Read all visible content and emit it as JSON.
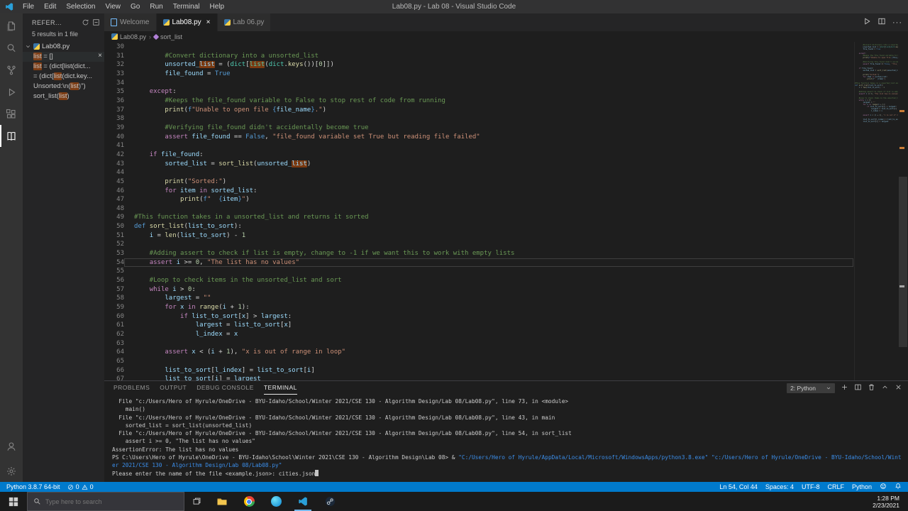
{
  "title_bar": {
    "title": "Lab08.py - Lab 08 - Visual Studio Code",
    "menus": [
      "File",
      "Edit",
      "Selection",
      "View",
      "Go",
      "Run",
      "Terminal",
      "Help"
    ]
  },
  "activity_bar": {
    "items": [
      "explorer",
      "search",
      "source-control",
      "run-and-debug",
      "extensions",
      "references"
    ],
    "active": "references",
    "bottom_items": [
      "account",
      "settings"
    ]
  },
  "sidebar": {
    "header": "REFER...",
    "summary": "5 results in 1 file",
    "file_name": "Lab08.py",
    "results": [
      {
        "active": true,
        "close": true,
        "segments": [
          {
            "t": "list",
            "h": true
          },
          {
            "t": " = []"
          }
        ]
      },
      {
        "segments": [
          {
            "t": "list",
            "h": true
          },
          {
            "t": " = (dict[list(dict..."
          }
        ]
      },
      {
        "segments": [
          {
            "t": "= (dict["
          },
          {
            "t": "list",
            "h": true
          },
          {
            "t": "(dict.key..."
          }
        ]
      },
      {
        "segments": [
          {
            "t": "Unsorted:\\n("
          },
          {
            "t": "list",
            "h": true
          },
          {
            "t": ")\")"
          }
        ]
      },
      {
        "segments": [
          {
            "t": "sort_list("
          },
          {
            "t": "list",
            "h": true
          },
          {
            "t": ")"
          }
        ]
      }
    ]
  },
  "editor_tabs": [
    {
      "label": "Welcome",
      "icon": "file",
      "active": false,
      "close": false
    },
    {
      "label": "Lab08.py",
      "icon": "python",
      "active": true,
      "close": true
    },
    {
      "label": "Lab 06.py",
      "icon": "python",
      "active": false,
      "close": false
    }
  ],
  "breadcrumbs": [
    {
      "label": "Lab08.py",
      "icon": "python"
    },
    {
      "label": "sort_list",
      "icon": "symbol-method"
    }
  ],
  "editor": {
    "current_line": 54,
    "lines": [
      {
        "n": 30,
        "tk": []
      },
      {
        "n": 31,
        "tk": [
          [
            "cm",
            "        #Convert dictionary into a unsorted_list"
          ]
        ]
      },
      {
        "n": 32,
        "tk": [
          [
            "op",
            "        "
          ],
          [
            "vr",
            "unsorted_"
          ],
          [
            "vr",
            "list",
            1
          ],
          [
            "op",
            " = ("
          ],
          [
            "ty",
            "dict"
          ],
          [
            "op",
            "["
          ],
          [
            "ty",
            "list",
            1
          ],
          [
            "op",
            "("
          ],
          [
            "ty",
            "dict"
          ],
          [
            "op",
            "."
          ],
          [
            "fn",
            "keys"
          ],
          [
            "op",
            "())["
          ],
          [
            "nu",
            "0"
          ],
          [
            "op",
            "]])"
          ]
        ]
      },
      {
        "n": 33,
        "tk": [
          [
            "op",
            "        "
          ],
          [
            "vr",
            "file_found"
          ],
          [
            "op",
            " = "
          ],
          [
            "kb",
            "True"
          ]
        ]
      },
      {
        "n": 34,
        "tk": []
      },
      {
        "n": 35,
        "tk": [
          [
            "op",
            "    "
          ],
          [
            "kw",
            "except"
          ],
          [
            "op",
            ":"
          ]
        ]
      },
      {
        "n": 36,
        "tk": [
          [
            "cm",
            "        #Keeps the file_found variable to False to stop rest of code from running"
          ]
        ]
      },
      {
        "n": 37,
        "tk": [
          [
            "op",
            "        "
          ],
          [
            "fn",
            "print"
          ],
          [
            "op",
            "("
          ],
          [
            "kb",
            "f"
          ],
          [
            "st",
            "\"Unable to open file "
          ],
          [
            "fb",
            "{"
          ],
          [
            "vr",
            "file_name"
          ],
          [
            "fb",
            "}"
          ],
          [
            "st",
            ".\""
          ],
          [
            "op",
            ")"
          ]
        ]
      },
      {
        "n": 38,
        "tk": []
      },
      {
        "n": 39,
        "tk": [
          [
            "cm",
            "        #Verifying file_found didn't accidentally become true"
          ]
        ]
      },
      {
        "n": 40,
        "tk": [
          [
            "op",
            "        "
          ],
          [
            "kw",
            "assert"
          ],
          [
            "op",
            " "
          ],
          [
            "vr",
            "file_found"
          ],
          [
            "op",
            " == "
          ],
          [
            "kb",
            "False"
          ],
          [
            "op",
            ", "
          ],
          [
            "st",
            "\"file_found variable set True but reading file failed\""
          ]
        ]
      },
      {
        "n": 41,
        "tk": []
      },
      {
        "n": 42,
        "tk": [
          [
            "op",
            "    "
          ],
          [
            "kw",
            "if"
          ],
          [
            "op",
            " "
          ],
          [
            "vr",
            "file_found"
          ],
          [
            "op",
            ":"
          ]
        ]
      },
      {
        "n": 43,
        "tk": [
          [
            "op",
            "        "
          ],
          [
            "vr",
            "sorted_list"
          ],
          [
            "op",
            " = "
          ],
          [
            "fn",
            "sort_list"
          ],
          [
            "op",
            "("
          ],
          [
            "vr",
            "unsorted_"
          ],
          [
            "vr",
            "list",
            1
          ],
          [
            "op",
            ")"
          ]
        ]
      },
      {
        "n": 44,
        "tk": []
      },
      {
        "n": 45,
        "tk": [
          [
            "op",
            "        "
          ],
          [
            "fn",
            "print"
          ],
          [
            "op",
            "("
          ],
          [
            "st",
            "\"Sorted:\""
          ],
          [
            "op",
            ")"
          ]
        ]
      },
      {
        "n": 46,
        "tk": [
          [
            "op",
            "        "
          ],
          [
            "kw",
            "for"
          ],
          [
            "op",
            " "
          ],
          [
            "vr",
            "item"
          ],
          [
            "op",
            " "
          ],
          [
            "kw",
            "in"
          ],
          [
            "op",
            " "
          ],
          [
            "vr",
            "sorted_list"
          ],
          [
            "op",
            ":"
          ]
        ]
      },
      {
        "n": 47,
        "tk": [
          [
            "op",
            "            "
          ],
          [
            "fn",
            "print"
          ],
          [
            "op",
            "("
          ],
          [
            "kb",
            "f"
          ],
          [
            "st",
            "\"  "
          ],
          [
            "fb",
            "{"
          ],
          [
            "vr",
            "item"
          ],
          [
            "fb",
            "}"
          ],
          [
            "st",
            "\""
          ],
          [
            "op",
            ")"
          ]
        ]
      },
      {
        "n": 48,
        "tk": []
      },
      {
        "n": 49,
        "tk": [
          [
            "cm",
            "#This function takes in a unsorted_list and returns it sorted"
          ]
        ]
      },
      {
        "n": 50,
        "tk": [
          [
            "kb",
            "def"
          ],
          [
            "op",
            " "
          ],
          [
            "fn",
            "sort_list"
          ],
          [
            "op",
            "("
          ],
          [
            "vr",
            "list_to_sort"
          ],
          [
            "op",
            "):"
          ]
        ]
      },
      {
        "n": 51,
        "tk": [
          [
            "op",
            "    "
          ],
          [
            "vr",
            "i"
          ],
          [
            "op",
            " = "
          ],
          [
            "fn",
            "len"
          ],
          [
            "op",
            "("
          ],
          [
            "vr",
            "list_to_sort"
          ],
          [
            "op",
            ") - "
          ],
          [
            "nu",
            "1"
          ]
        ]
      },
      {
        "n": 52,
        "tk": []
      },
      {
        "n": 53,
        "tk": [
          [
            "cm",
            "    #Adding assert to check if list is empty, change to -1 if we want this to work with empty lists"
          ]
        ]
      },
      {
        "n": 54,
        "tk": [
          [
            "op",
            "    "
          ],
          [
            "kw",
            "assert"
          ],
          [
            "op",
            " "
          ],
          [
            "vr",
            "i"
          ],
          [
            "op",
            " >= "
          ],
          [
            "nu",
            "0"
          ],
          [
            "op",
            ", "
          ],
          [
            "st",
            "\"The list has no values\""
          ]
        ]
      },
      {
        "n": 55,
        "tk": []
      },
      {
        "n": 56,
        "tk": [
          [
            "cm",
            "    #Loop to check items in the unsorted_list and sort"
          ]
        ]
      },
      {
        "n": 57,
        "tk": [
          [
            "op",
            "    "
          ],
          [
            "kw",
            "while"
          ],
          [
            "op",
            " "
          ],
          [
            "vr",
            "i"
          ],
          [
            "op",
            " > "
          ],
          [
            "nu",
            "0"
          ],
          [
            "op",
            ":"
          ]
        ]
      },
      {
        "n": 58,
        "tk": [
          [
            "op",
            "        "
          ],
          [
            "vr",
            "largest"
          ],
          [
            "op",
            " = "
          ],
          [
            "st",
            "\"\""
          ]
        ]
      },
      {
        "n": 59,
        "tk": [
          [
            "op",
            "        "
          ],
          [
            "kw",
            "for"
          ],
          [
            "op",
            " "
          ],
          [
            "vr",
            "x"
          ],
          [
            "op",
            " "
          ],
          [
            "kw",
            "in"
          ],
          [
            "op",
            " "
          ],
          [
            "fn",
            "range"
          ],
          [
            "op",
            "("
          ],
          [
            "vr",
            "i"
          ],
          [
            "op",
            " + "
          ],
          [
            "nu",
            "1"
          ],
          [
            "op",
            "):"
          ]
        ]
      },
      {
        "n": 60,
        "tk": [
          [
            "op",
            "            "
          ],
          [
            "kw",
            "if"
          ],
          [
            "op",
            " "
          ],
          [
            "vr",
            "list_to_sort"
          ],
          [
            "op",
            "["
          ],
          [
            "vr",
            "x"
          ],
          [
            "op",
            "] > "
          ],
          [
            "vr",
            "largest"
          ],
          [
            "op",
            ":"
          ]
        ]
      },
      {
        "n": 61,
        "tk": [
          [
            "op",
            "                "
          ],
          [
            "vr",
            "largest"
          ],
          [
            "op",
            " = "
          ],
          [
            "vr",
            "list_to_sort"
          ],
          [
            "op",
            "["
          ],
          [
            "vr",
            "x"
          ],
          [
            "op",
            "]"
          ]
        ]
      },
      {
        "n": 62,
        "tk": [
          [
            "op",
            "                "
          ],
          [
            "vr",
            "l_index"
          ],
          [
            "op",
            " = "
          ],
          [
            "vr",
            "x"
          ]
        ]
      },
      {
        "n": 63,
        "tk": []
      },
      {
        "n": 64,
        "tk": [
          [
            "op",
            "        "
          ],
          [
            "kw",
            "assert"
          ],
          [
            "op",
            " "
          ],
          [
            "vr",
            "x"
          ],
          [
            "op",
            " < ("
          ],
          [
            "vr",
            "i"
          ],
          [
            "op",
            " + "
          ],
          [
            "nu",
            "1"
          ],
          [
            "op",
            "), "
          ],
          [
            "st",
            "\"x is out of range in loop\""
          ]
        ]
      },
      {
        "n": 65,
        "tk": []
      },
      {
        "n": 66,
        "tk": [
          [
            "op",
            "        "
          ],
          [
            "vr",
            "list_to_sort"
          ],
          [
            "op",
            "["
          ],
          [
            "vr",
            "l_index"
          ],
          [
            "op",
            "] = "
          ],
          [
            "vr",
            "list_to_sort"
          ],
          [
            "op",
            "["
          ],
          [
            "vr",
            "i"
          ],
          [
            "op",
            "]"
          ]
        ]
      },
      {
        "n": 67,
        "tk": [
          [
            "op",
            "        "
          ],
          [
            "vr",
            "list_to_sort"
          ],
          [
            "op",
            "["
          ],
          [
            "vr",
            "i"
          ],
          [
            "op",
            "] = "
          ],
          [
            "vr",
            "largest"
          ]
        ]
      }
    ]
  },
  "panel": {
    "tabs": [
      "PROBLEMS",
      "OUTPUT",
      "DEBUG CONSOLE",
      "TERMINAL"
    ],
    "active_tab": "TERMINAL",
    "terminal_selector": "2: Python",
    "terminal_lines": [
      {
        "s": [
          {
            "t": "  File \"c:/Users/Hero of Hyrule/OneDrive - BYU-Idaho/School/Winter 2021/CSE 130 - Algorithm Design/Lab 08/Lab08.py\", line 73, in <module>"
          }
        ]
      },
      {
        "s": [
          {
            "t": "    main()"
          }
        ]
      },
      {
        "s": [
          {
            "t": "  File \"c:/Users/Hero of Hyrule/OneDrive - BYU-Idaho/School/Winter 2021/CSE 130 - Algorithm Design/Lab 08/Lab08.py\", line 43, in main"
          }
        ]
      },
      {
        "s": [
          {
            "t": "    sorted_list = sort_list(unsorted_list)"
          }
        ]
      },
      {
        "s": [
          {
            "t": "  File \"c:/Users/Hero of Hyrule/OneDrive - BYU-Idaho/School/Winter 2021/CSE 130 - Algorithm Design/Lab 08/Lab08.py\", line 54, in sort_list"
          }
        ]
      },
      {
        "s": [
          {
            "t": "    assert i >= 0, \"The list has no values\""
          }
        ]
      },
      {
        "s": [
          {
            "t": "AssertionError: The list has no values"
          }
        ]
      },
      {
        "s": [
          {
            "t": "PS C:\\Users\\Hero of Hyrule\\OneDrive - BYU-Idaho\\School\\Winter 2021\\CSE 130 - Algorithm Design\\Lab 08> & "
          },
          {
            "t": "\"C:/Users/Hero of Hyrule/AppData/Local/Microsoft/WindowsApps/python3.8.exe\"",
            "c": "blue"
          },
          {
            "t": " "
          },
          {
            "t": "\"c:/Users/Hero of Hyrule/OneDrive - BYU-Idaho/School/Wint",
            "c": "blue"
          }
        ]
      },
      {
        "s": [
          {
            "t": "er 2021/CSE 130 - Algorithm Design/Lab 08/Lab08.py\"",
            "c": "blue"
          }
        ]
      },
      {
        "s": [
          {
            "t": "Please enter the name of the file <example.json>: cities.json"
          }
        ],
        "cursor": true
      }
    ]
  },
  "status_bar": {
    "python_version": "Python 3.8.7 64-bit",
    "errors": "0",
    "warnings": "0",
    "line_col": "Ln 54, Col 44",
    "indent": "Spaces: 4",
    "encoding": "UTF-8",
    "eol": "CRLF",
    "language": "Python"
  },
  "taskbar": {
    "search_placeholder": "Type here to search",
    "clock_time": "1:28 PM",
    "clock_date": "2/23/2021"
  }
}
